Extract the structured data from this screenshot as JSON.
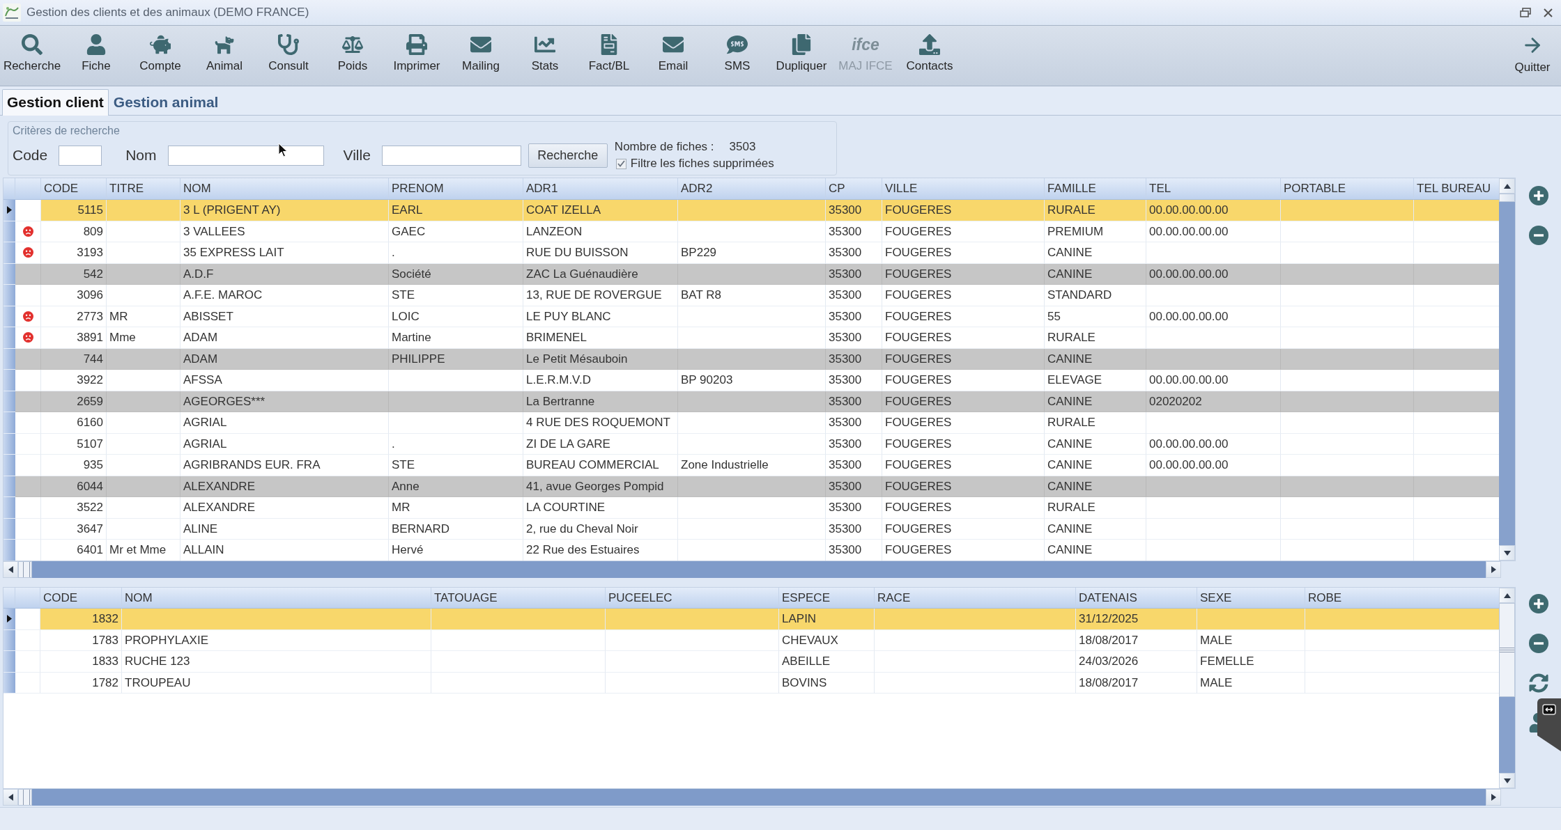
{
  "window": {
    "title": "Gestion des clients et des animaux (DEMO FRANCE)"
  },
  "toolbar": {
    "items": [
      {
        "label": "Recherche",
        "disabled": false
      },
      {
        "label": "Fiche",
        "disabled": false
      },
      {
        "label": "Compte",
        "disabled": false
      },
      {
        "label": "Animal",
        "disabled": false
      },
      {
        "label": "Consult",
        "disabled": false
      },
      {
        "label": "Poids",
        "disabled": false
      },
      {
        "label": "Imprimer",
        "disabled": false
      },
      {
        "label": "Mailing",
        "disabled": false
      },
      {
        "label": "Stats",
        "disabled": false
      },
      {
        "label": "Fact/BL",
        "disabled": false
      },
      {
        "label": "Email",
        "disabled": false
      },
      {
        "label": "SMS",
        "disabled": false
      },
      {
        "label": "Dupliquer",
        "disabled": false
      },
      {
        "label": "MAJ IFCE",
        "disabled": true,
        "logo": "ifce"
      },
      {
        "label": "Contacts",
        "disabled": false
      }
    ],
    "exit": {
      "label": "Quitter"
    }
  },
  "tabs": [
    {
      "label": "Gestion client",
      "selected": true
    },
    {
      "label": "Gestion animal",
      "selected": false
    }
  ],
  "search": {
    "legend": "Critères de recherche",
    "fields": [
      {
        "label": "Code"
      },
      {
        "label": "Nom"
      },
      {
        "label": "Ville"
      }
    ],
    "button": "Recherche",
    "count_label": "Nombre de fiches :",
    "count": "3503",
    "filter": {
      "label": "Filtre les fiches supprimées",
      "checked": true
    }
  },
  "clients": {
    "columns": [
      "CODE",
      "TITRE",
      "NOM",
      "PRENOM",
      "ADR1",
      "ADR2",
      "CP",
      "VILLE",
      "FAMILLE",
      "TEL",
      "PORTABLE",
      "TEL BUREAU"
    ],
    "rows": [
      {
        "code": "5115",
        "nom": "3 L (PRIGENT AY)",
        "prenom": "EARL",
        "adr1": "COAT IZELLA",
        "cp": "35300",
        "ville": "FOUGERES",
        "famille": "RURALE",
        "tel": "00.00.00.00.00",
        "selected": true,
        "alert": false,
        "inactive": false
      },
      {
        "code": "809",
        "nom": "3 VALLEES",
        "prenom": "GAEC",
        "adr1": "LANZEON",
        "cp": "35300",
        "ville": "FOUGERES",
        "famille": "PREMIUM",
        "tel": "00.00.00.00.00",
        "selected": false,
        "alert": true,
        "inactive": false
      },
      {
        "code": "3193",
        "nom": "35 EXPRESS LAIT",
        "prenom": ".",
        "adr1": "RUE DU BUISSON",
        "adr2": "BP229",
        "cp": "35300",
        "ville": "FOUGERES",
        "famille": "CANINE",
        "selected": false,
        "alert": true,
        "inactive": false
      },
      {
        "code": "542",
        "nom": "A.D.F",
        "prenom": "Société",
        "adr1": "ZAC La Guénaudière",
        "cp": "35300",
        "ville": "FOUGERES",
        "famille": "CANINE",
        "tel": "00.00.00.00.00",
        "selected": false,
        "alert": false,
        "inactive": true
      },
      {
        "code": "3096",
        "nom": "A.F.E. MAROC",
        "prenom": "STE",
        "adr1": "13, RUE DE ROVERGUE",
        "adr2": "BAT R8",
        "cp": "35300",
        "ville": "FOUGERES",
        "famille": "STANDARD",
        "selected": false,
        "alert": false,
        "inactive": false
      },
      {
        "code": "2773",
        "titre": "MR",
        "nom": "ABISSET",
        "prenom": "LOIC",
        "adr1": "LE PUY BLANC",
        "cp": "35300",
        "ville": "FOUGERES",
        "famille": "55",
        "tel": "00.00.00.00.00",
        "selected": false,
        "alert": true,
        "inactive": false
      },
      {
        "code": "3891",
        "titre": "Mme",
        "nom": "ADAM",
        "prenom": "Martine",
        "adr1": "BRIMENEL",
        "cp": "35300",
        "ville": "FOUGERES",
        "famille": "RURALE",
        "selected": false,
        "alert": true,
        "inactive": false
      },
      {
        "code": "744",
        "nom": "ADAM",
        "prenom": "PHILIPPE",
        "adr1": "Le Petit Mésauboin",
        "cp": "35300",
        "ville": "FOUGERES",
        "famille": "CANINE",
        "selected": false,
        "alert": false,
        "inactive": true
      },
      {
        "code": "3922",
        "nom": "AFSSA",
        "adr1": "L.E.R.M.V.D",
        "adr2": "BP 90203",
        "cp": "35300",
        "ville": "FOUGERES",
        "famille": "ELEVAGE",
        "tel": "00.00.00.00.00",
        "selected": false,
        "alert": false,
        "inactive": false
      },
      {
        "code": "2659",
        "nom": "AGEORGES***",
        "adr1": "La Bertranne",
        "cp": "35300",
        "ville": "FOUGERES",
        "famille": "CANINE",
        "tel": "02020202",
        "selected": false,
        "alert": false,
        "inactive": true
      },
      {
        "code": "6160",
        "nom": "AGRIAL",
        "adr1": "4 RUE DES ROQUEMONT",
        "cp": "35300",
        "ville": "FOUGERES",
        "famille": "RURALE",
        "selected": false,
        "alert": false,
        "inactive": false
      },
      {
        "code": "5107",
        "nom": "AGRIAL",
        "prenom": ".",
        "adr1": "ZI DE LA GARE",
        "cp": "35300",
        "ville": "FOUGERES",
        "famille": "CANINE",
        "tel": "00.00.00.00.00",
        "selected": false,
        "alert": false,
        "inactive": false
      },
      {
        "code": "935",
        "nom": "AGRIBRANDS EUR. FRA",
        "prenom": "STE",
        "adr1": "BUREAU COMMERCIAL",
        "adr2": "Zone Industrielle",
        "cp": "35300",
        "ville": "FOUGERES",
        "famille": "CANINE",
        "tel": "00.00.00.00.00",
        "selected": false,
        "alert": false,
        "inactive": false
      },
      {
        "code": "6044",
        "nom": "ALEXANDRE",
        "prenom": "Anne",
        "adr1": "41, avue Georges Pompid",
        "cp": "35300",
        "ville": "FOUGERES",
        "famille": "CANINE",
        "selected": false,
        "alert": false,
        "inactive": true
      },
      {
        "code": "3522",
        "nom": "ALEXANDRE",
        "prenom": "MR",
        "adr1": "LA COURTINE",
        "cp": "35300",
        "ville": "FOUGERES",
        "famille": "RURALE",
        "selected": false,
        "alert": false,
        "inactive": false
      },
      {
        "code": "3647",
        "nom": "ALINE",
        "prenom": "BERNARD",
        "adr1": "2, rue du Cheval Noir",
        "cp": "35300",
        "ville": "FOUGERES",
        "famille": "CANINE",
        "selected": false,
        "alert": false,
        "inactive": false
      },
      {
        "code": "6401",
        "titre": "Mr et Mme",
        "nom": "ALLAIN",
        "prenom": "Hervé",
        "adr1": "22 Rue des Estuaires",
        "cp": "35300",
        "ville": "FOUGERES",
        "famille": "CANINE",
        "selected": false,
        "alert": false,
        "inactive": false
      }
    ]
  },
  "animals": {
    "columns": [
      "CODE",
      "NOM",
      "TATOUAGE",
      "PUCEELEC",
      "ESPECE",
      "RACE",
      "DATENAIS",
      "SEXE",
      "ROBE"
    ],
    "rows": [
      {
        "code": "1832",
        "espece": "LAPIN",
        "datenais": "31/12/2025",
        "selected": true
      },
      {
        "code": "1783",
        "nom": "PROPHYLAXIE",
        "espece": "CHEVAUX",
        "datenais": "18/08/2017",
        "sexe": "MALE",
        "selected": false
      },
      {
        "code": "1833",
        "nom": "RUCHE 123",
        "espece": "ABEILLE",
        "datenais": "24/03/2026",
        "sexe": "FEMELLE",
        "selected": false
      },
      {
        "code": "1782",
        "nom": "TROUPEAU",
        "espece": "BOVINS",
        "datenais": "18/08/2017",
        "sexe": "MALE",
        "selected": false
      }
    ]
  }
}
